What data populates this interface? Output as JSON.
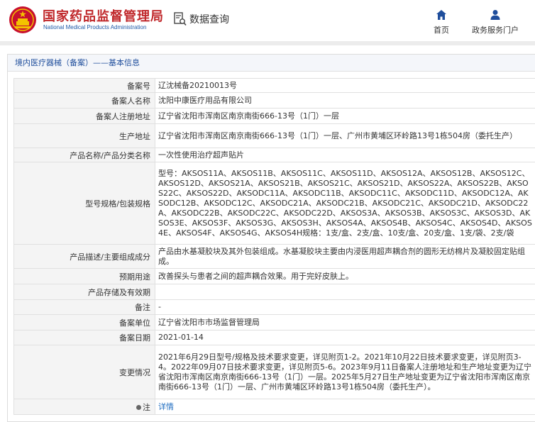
{
  "header": {
    "brand_cn": "国家药品监督管理局",
    "brand_en": "National Medical Products Administration",
    "query_title": "数据查询",
    "nav": [
      {
        "label": "首页",
        "icon": "home-icon"
      },
      {
        "label": "政务服务门户",
        "icon": "user-icon"
      }
    ],
    "brand_color": "#c0282b",
    "accent_color": "#1f4e9c"
  },
  "breadcrumb": "境内医疗器械（备案）——基本信息",
  "fields": {
    "record_no": {
      "label": "备案号",
      "value": "辽沈械备20210013号"
    },
    "filer_name": {
      "label": "备案人名称",
      "value": "沈阳中康医疗用品有限公司"
    },
    "filer_address": {
      "label": "备案人注册地址",
      "value": "辽宁省沈阳市浑南区南京南街666-13号（1门）一层"
    },
    "production_address": {
      "label": "生产地址",
      "value": "辽宁省沈阳市浑南区南京南街666-13号（1门）一层、广州市黄埔区环岭路13号1栋504房（委托生产）"
    },
    "product_name": {
      "label": "产品名称/产品分类名称",
      "value": "一次性使用治疗超声贴片"
    },
    "models": {
      "label": "型号规格/包装规格",
      "value": "型号：AKSOS11A、AKSOS11B、AKSOS11C、AKSOS11D、AKSOS12A、AKSOS12B、AKSOS12C、AKSOS12D、AKSOS21A、AKSOS21B、AKSOS21C、AKSOS21D、AKSOS22A、AKSOS22B、AKSOS22C、AKSOS22D、AKSODC11A、AKSODC11B、AKSODC11C、AKSODC11D、AKSODC12A、AKSODC12B、AKSODC12C、AKSODC21A、AKSODC21B、AKSODC21C、AKSODC21D、AKSODC22A、AKSODC22B、AKSODC22C、AKSODC22D、AKSOS3A、AKSOS3B、AKSOS3C、AKSOS3D、AKSOS3E、AKSOS3F、AKSOS3G、AKSOS3H、AKSOS4A、AKSOS4B、AKSOS4C、AKSOS4D、AKSOS4E、AKSOS4F、AKSOS4G、AKSOS4H规格：1支/盒、2支/盒、10支/盒、20支/盒、1支/袋、2支/袋"
    },
    "description": {
      "label": "产品描述/主要组成成分",
      "value": "产品由水基凝胶块及其外包装组成。水基凝胶块主要由内浸医用超声耦合剂的圆形无纺棉片及凝胶固定贴组成。"
    },
    "intended_use": {
      "label": "预期用途",
      "value": "改善探头与患者之间的超声耦合效果。用于完好皮肤上。"
    },
    "storage": {
      "label": "产品存储及有效期",
      "value": ""
    },
    "remark": {
      "label": "备注",
      "value": "-"
    },
    "filing_unit": {
      "label": "备案单位",
      "value": "辽宁省沈阳市市场监督管理局"
    },
    "filing_date": {
      "label": "备案日期",
      "value": "2021-01-14"
    },
    "changes": {
      "label": "变更情况",
      "value": "2021年6月29日型号/规格及技术要求变更，详见附页1-2。2021年10月22日技术要求变更，详见附页3-4。2022年09月07日技术要求变更，详见附页5-6。2023年9月11日备案人注册地址和生产地址变更为辽宁省沈阳市浑南区南京南街666-13号（1门）一层。2025年5月27日生产地址变更为辽宁省沈阳市浑南区南京南街666-13号（1门）一层、广州市黄埔区环岭路13号1栋504房（委托生产）。"
    },
    "note": {
      "label": "注",
      "value": "详情"
    }
  }
}
